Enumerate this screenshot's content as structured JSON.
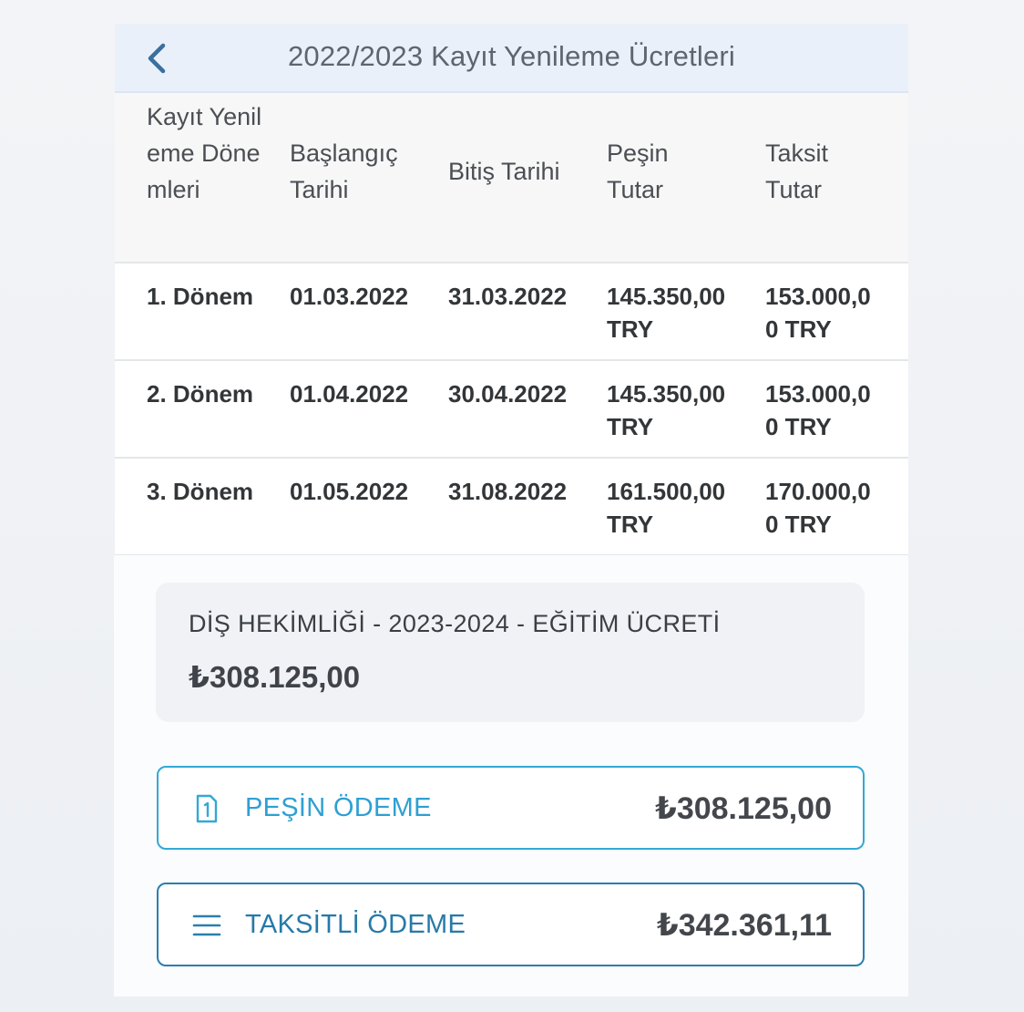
{
  "header": {
    "title": "2022/2023 Kayıt Yenileme Ücretleri",
    "back_icon": "chevron-left-icon",
    "accent_color": "#3a6f9e"
  },
  "fee_table": {
    "columns": [
      "Kayıt Yenileme Dönemleri",
      "Başlangıç Tarihi",
      "Bitiş Tarihi",
      "Peşin Tutar",
      "Taksit Tutar"
    ],
    "rows": [
      {
        "period": "1. Dönem",
        "start": "01.03.2022",
        "end": "31.03.2022",
        "cash": "145.350,00 TRY",
        "installment": "153.000,00 TRY"
      },
      {
        "period": "2. Dönem",
        "start": "01.04.2022",
        "end": "30.04.2022",
        "cash": "145.350,00 TRY",
        "installment": "153.000,00 TRY"
      },
      {
        "period": "3. Dönem",
        "start": "01.05.2022",
        "end": "31.08.2022",
        "cash": "161.500,00 TRY",
        "installment": "170.000,00 TRY"
      }
    ]
  },
  "payment": {
    "fee_title": "DİŞ HEKİMLİĞİ - 2023-2024 - EĞİTİM ÜCRETİ",
    "fee_amount": "₺308.125,00",
    "options": [
      {
        "label": "PEŞİN ÖDEME",
        "amount": "₺308.125,00",
        "icon": "document-one-icon",
        "color": "#33a8d6"
      },
      {
        "label": "TAKSİTLİ ÖDEME",
        "amount": "₺342.361,11",
        "icon": "menu-lines-icon",
        "color": "#2a7fae"
      }
    ]
  }
}
